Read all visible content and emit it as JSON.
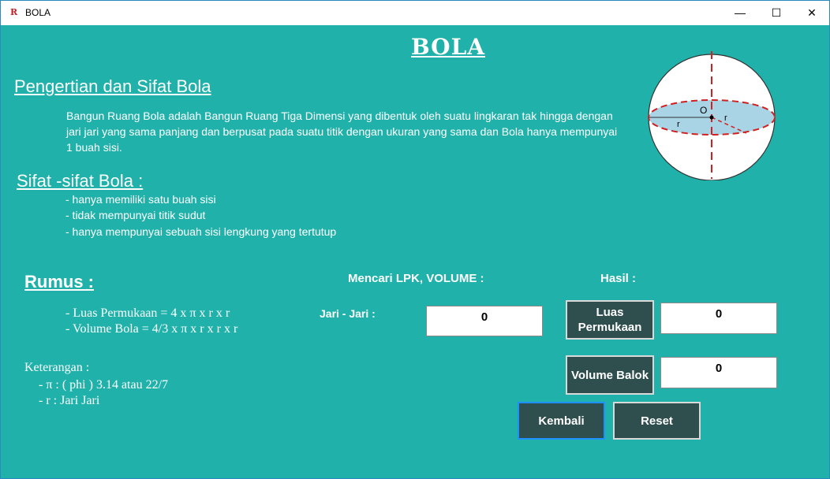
{
  "window": {
    "title": "BOLA",
    "app_icon": "R",
    "minimize": "—",
    "maximize": "☐",
    "close": "✕"
  },
  "main_title": "BOLA",
  "pengertian": {
    "heading": "Pengertian dan Sifat Bola",
    "text": "Bangun Ruang Bola adalah Bangun Ruang Tiga Dimensi yang dibentuk oleh suatu lingkaran tak hingga dengan jari jari yang sama panjang dan berpusat pada suatu titik dengan ukuran yang sama dan Bola hanya mempunyai 1 buah sisi."
  },
  "sifat": {
    "heading": "Sifat -sifat Bola :",
    "items": [
      "- hanya memiliki satu buah sisi",
      "- tidak mempunyai titik sudut",
      "- hanya mempunyai sebuah sisi lengkung yang tertutup"
    ]
  },
  "diagram": {
    "center_label": "O",
    "radius_left": "r",
    "radius_right": "r"
  },
  "rumus": {
    "heading": "Rumus :",
    "luas": "- Luas Permukaan = 4 x π x r x r",
    "volume": "- Volume Bola = 4/3 x π x r x r x r"
  },
  "keterangan": {
    "heading": "Keterangan :",
    "pi": "- π : ( phi ) 3.14 atau 22/7",
    "r": "- r :  Jari Jari"
  },
  "calc": {
    "mencari_label": "Mencari LPK, VOLUME :",
    "hasil_label": "Hasil    :",
    "jari_label": "Jari - Jari   :",
    "jari_value": "0",
    "luas_button": "Luas Permukaan",
    "luas_result": "0",
    "volume_button": "Volume Balok",
    "volume_result": "0",
    "kembali_button": "Kembali",
    "reset_button": "Reset"
  }
}
